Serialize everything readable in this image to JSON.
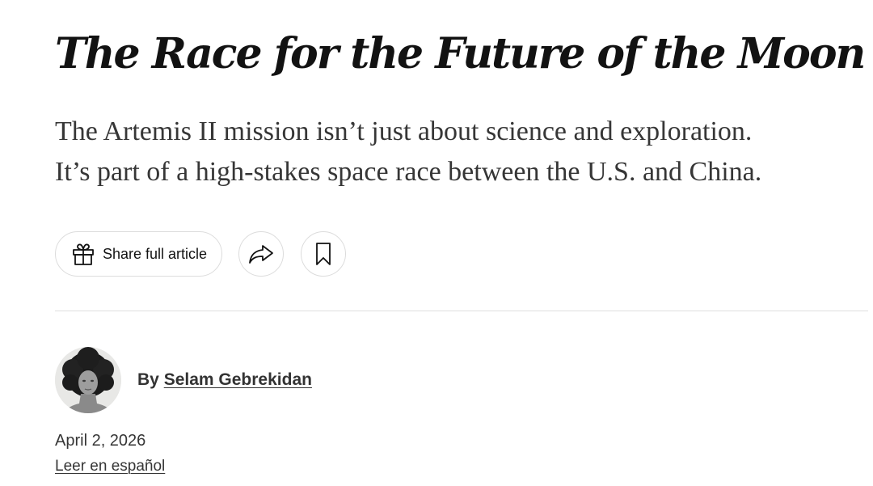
{
  "article": {
    "headline": "The Race for the Future of the Moon",
    "summary_lines": [
      "The Artemis II mission isn’t just about science and exploration.",
      "It’s part of a high-stakes space race between the U.S. and China."
    ]
  },
  "share_bar": {
    "share_full_article_label": "Share full article",
    "icons": {
      "gift": "gift-icon",
      "share": "share-arrow-icon",
      "save": "bookmark-icon"
    }
  },
  "byline": {
    "prefix": "By",
    "author": "Selam Gebrekidan"
  },
  "meta": {
    "date": "April 2, 2026",
    "translation_link": "Leer en español"
  }
}
